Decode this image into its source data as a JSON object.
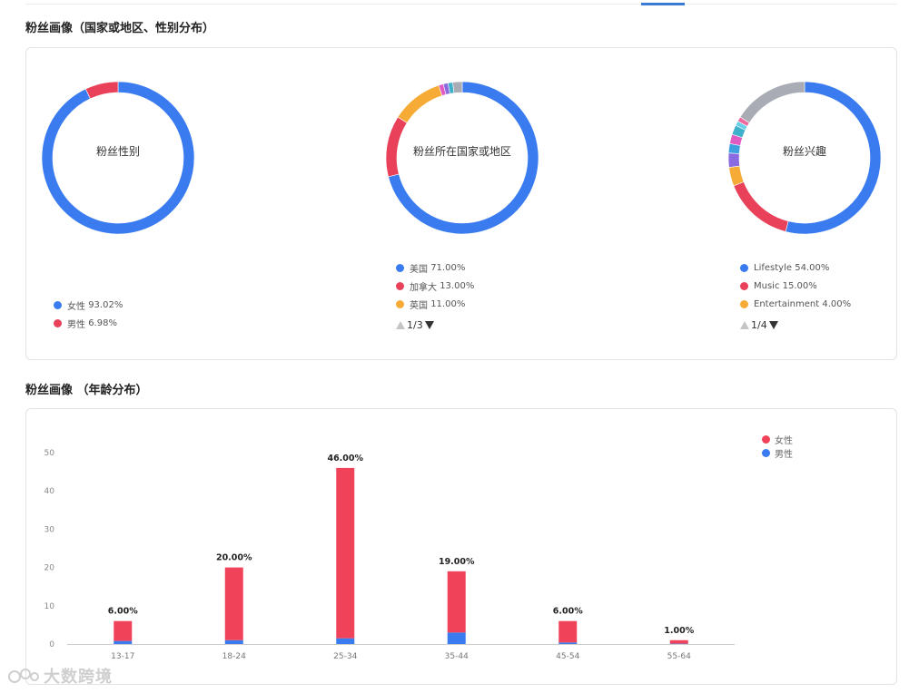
{
  "section1": {
    "title": "粉丝画像（国家或地区、性别分布）"
  },
  "gender": {
    "label": "粉丝性别",
    "segments": [
      {
        "name": "女性",
        "pct_text": "93.02%",
        "value": 93.02,
        "color": "#3a7bf0"
      },
      {
        "name": "男性",
        "pct_text": "6.98%",
        "value": 6.98,
        "color": "#e9415a"
      }
    ]
  },
  "country": {
    "label": "粉丝所在国家或地区",
    "legend": [
      {
        "name": "美国",
        "pct_text": "71.00%",
        "color": "#3a7bf0"
      },
      {
        "name": "加拿大",
        "pct_text": "13.00%",
        "color": "#e9415a"
      },
      {
        "name": "英国",
        "pct_text": "11.00%",
        "color": "#f5ab35"
      }
    ],
    "segments": [
      {
        "value": 71,
        "color": "#3a7bf0"
      },
      {
        "value": 13,
        "color": "#e9415a"
      },
      {
        "value": 11,
        "color": "#f5ab35"
      },
      {
        "value": 1,
        "color": "#e05bc2"
      },
      {
        "value": 1,
        "color": "#8a6ae0"
      },
      {
        "value": 1,
        "color": "#3fb0c9"
      },
      {
        "value": 2,
        "color": "#a9acb4"
      }
    ],
    "pager": "1/3"
  },
  "interest": {
    "label": "粉丝兴趣",
    "legend": [
      {
        "name": "Lifestyle",
        "pct_text": "54.00%",
        "color": "#3a7bf0"
      },
      {
        "name": "Music",
        "pct_text": "15.00%",
        "color": "#e9415a"
      },
      {
        "name": "Entertainment",
        "pct_text": "4.00%",
        "color": "#f5ab35"
      }
    ],
    "segments": [
      {
        "value": 54,
        "color": "#3a7bf0"
      },
      {
        "value": 15,
        "color": "#e9415a"
      },
      {
        "value": 4,
        "color": "#f5ab35"
      },
      {
        "value": 3,
        "color": "#8a6ae0"
      },
      {
        "value": 2,
        "color": "#3fa0e0"
      },
      {
        "value": 2,
        "color": "#e05bc2"
      },
      {
        "value": 2,
        "color": "#3fb0c9"
      },
      {
        "value": 1,
        "color": "#6ad0e8"
      },
      {
        "value": 1,
        "color": "#f06aa0"
      },
      {
        "value": 16,
        "color": "#a9acb4"
      }
    ],
    "pager": "1/4"
  },
  "section2": {
    "title": "粉丝画像 （年龄分布）"
  },
  "chart_data": {
    "type": "bar",
    "stacked": true,
    "categories": [
      "13-17",
      "18-24",
      "25-34",
      "35-44",
      "45-54",
      "55-64"
    ],
    "series": [
      {
        "name": "女性",
        "color": "#f0435a",
        "values": [
          5.2,
          19.0,
          44.5,
          16.0,
          5.6,
          0.9
        ]
      },
      {
        "name": "男性",
        "color": "#3a7bf0",
        "values": [
          0.8,
          1.0,
          1.5,
          3.0,
          0.4,
          0.1
        ]
      }
    ],
    "totals_text": [
      "6.00%",
      "20.00%",
      "46.00%",
      "19.00%",
      "6.00%",
      "1.00%"
    ],
    "y_ticks": [
      0,
      10,
      20,
      30,
      40,
      50
    ],
    "ylim": [
      0,
      50
    ],
    "legend_position": "top-right",
    "grid": false
  },
  "watermark": {
    "text": "大数跨境"
  }
}
